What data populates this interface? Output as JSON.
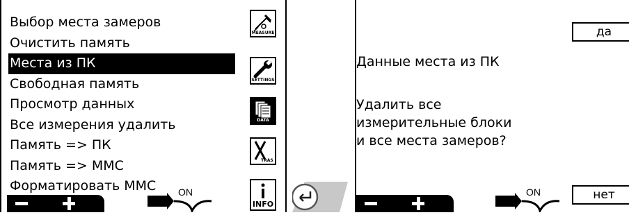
{
  "left_screen": {
    "menu": [
      {
        "label": "Выбор места замеров",
        "selected": false
      },
      {
        "label": "Очистить память",
        "selected": false
      },
      {
        "label": "Места из ПК",
        "selected": true
      },
      {
        "label": "Свободная память",
        "selected": false
      },
      {
        "label": "Просмотр данных",
        "selected": false
      },
      {
        "label": "Все измерения удалить",
        "selected": false
      },
      {
        "label": "Память => ПК",
        "selected": false
      },
      {
        "label": "Память => MMC",
        "selected": false
      },
      {
        "label": "Форматировать MMC",
        "selected": false
      }
    ],
    "side_icons": {
      "measure": "MEASURE",
      "settings": "SETTINGS",
      "data": "DATA",
      "xtras": "TRAS",
      "info": "INFO"
    },
    "power_label": "ON"
  },
  "right_screen": {
    "yes_button": "да",
    "no_button": "нет",
    "title": "Данные места  из ПК",
    "question_lines": [
      "Удалить все",
      "измерительные блоки",
      "и все места замеров?"
    ],
    "power_label": "ON"
  }
}
